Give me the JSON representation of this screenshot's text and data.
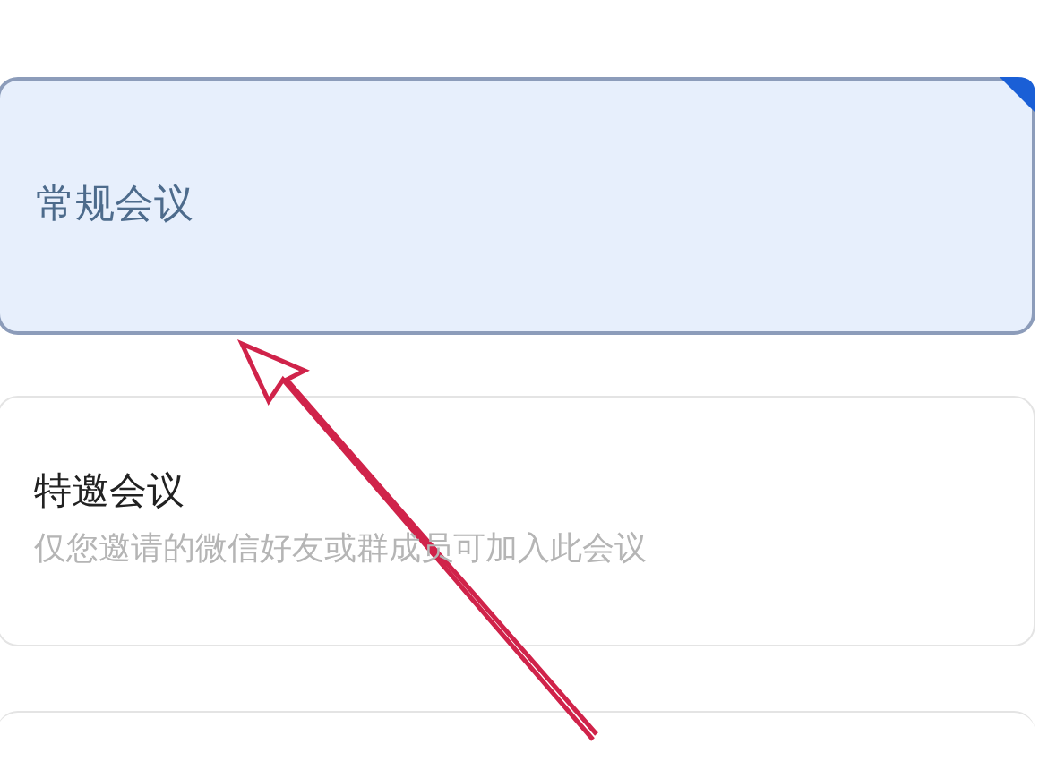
{
  "meeting_types": [
    {
      "title": "常规会议",
      "selected": true
    },
    {
      "title": "特邀会议",
      "description": "仅您邀请的微信好友或群成员可加入此会议",
      "selected": false
    }
  ]
}
